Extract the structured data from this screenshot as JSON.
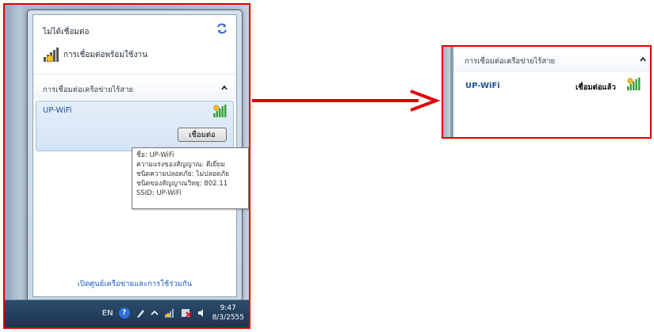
{
  "flyout": {
    "status_title": "ไม่ได้เชื่อมต่อ",
    "connections_available": "การเชื่อมต่อพร้อมใช้งาน",
    "section_title": "การเชื่อมต่อเครือข่ายไร้สาย",
    "network": {
      "name": "UP-WiFi",
      "connect_label": "เชื่อมต่อ"
    },
    "tooltip": {
      "line1": "ชื่อ: UP-WiFi",
      "line2": "ความแรงของสัญญาณ: ดีเยี่ยม",
      "line3": "ชนิดความปลอดภัย: ไม่ปลอดภัย",
      "line4": "ชนิดของสัญญาณวิทยุ: 802.11",
      "line5": "SSID: UP-WiFi"
    },
    "footer_link": "เปิดศูนย์เครือข่ายและการใช้ร่วมกัน"
  },
  "taskbar": {
    "lang": "EN",
    "time": "9:47",
    "date": "8/3/2555"
  },
  "zoom": {
    "section_title": "การเชื่อมต่อเครือข่ายไร้สาย",
    "network_name": "UP-WiFi",
    "status": "เชื่อมต่อแล้ว"
  },
  "colors": {
    "frame_border": "#e00000",
    "arrow": "#e00000",
    "link": "#1f5fbf"
  }
}
